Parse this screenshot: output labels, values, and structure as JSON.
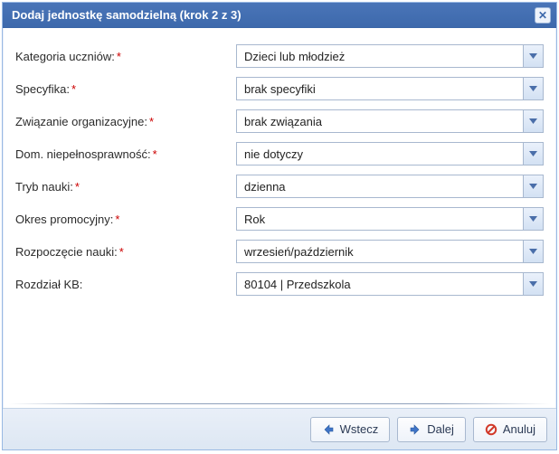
{
  "dialog": {
    "title": "Dodaj jednostkę samodzielną (krok 2 z 3)"
  },
  "fields": [
    {
      "label": "Kategoria uczniów:",
      "required": true,
      "value": "Dzieci lub młodzież"
    },
    {
      "label": "Specyfika:",
      "required": true,
      "value": "brak specyfiki"
    },
    {
      "label": "Związanie organizacyjne:",
      "required": true,
      "value": "brak związania"
    },
    {
      "label": "Dom. niepełnosprawność:",
      "required": true,
      "value": "nie dotyczy"
    },
    {
      "label": "Tryb nauki:",
      "required": true,
      "value": "dzienna"
    },
    {
      "label": "Okres promocyjny:",
      "required": true,
      "value": "Rok"
    },
    {
      "label": "Rozpoczęcie nauki:",
      "required": true,
      "value": "wrzesień/październik"
    },
    {
      "label": "Rozdział KB:",
      "required": false,
      "value": "80104 | Przedszkola"
    }
  ],
  "buttons": {
    "back": "Wstecz",
    "next": "Dalej",
    "cancel": "Anuluj"
  }
}
